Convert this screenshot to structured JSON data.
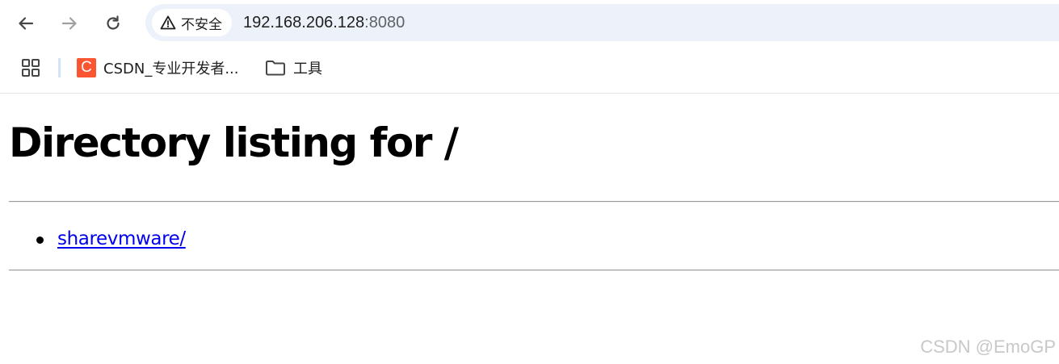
{
  "browser": {
    "nav": {
      "back_icon": "arrow-left-icon",
      "forward_icon": "arrow-right-icon",
      "reload_icon": "reload-icon"
    },
    "omnibox": {
      "security_label": "不安全",
      "security_icon": "warning-triangle-icon",
      "host": "192.168.206.128",
      "port": ":8080"
    },
    "bookmarks": {
      "apps_icon": "apps-grid-icon",
      "items": [
        {
          "label": "CSDN_专业开发者...",
          "favicon_letter": "C",
          "icon": "csdn-favicon"
        },
        {
          "label": "工具",
          "icon": "folder-icon"
        }
      ]
    }
  },
  "page": {
    "title": "Directory listing for /",
    "entries": [
      {
        "name": "sharevmware/"
      }
    ]
  },
  "watermark": "CSDN @EmoGP",
  "colors": {
    "omnibox_bg": "#edf2fa",
    "link": "#0000ee",
    "csdn_brand": "#fc5531",
    "bookmark_divider": "#d3e3fd"
  }
}
